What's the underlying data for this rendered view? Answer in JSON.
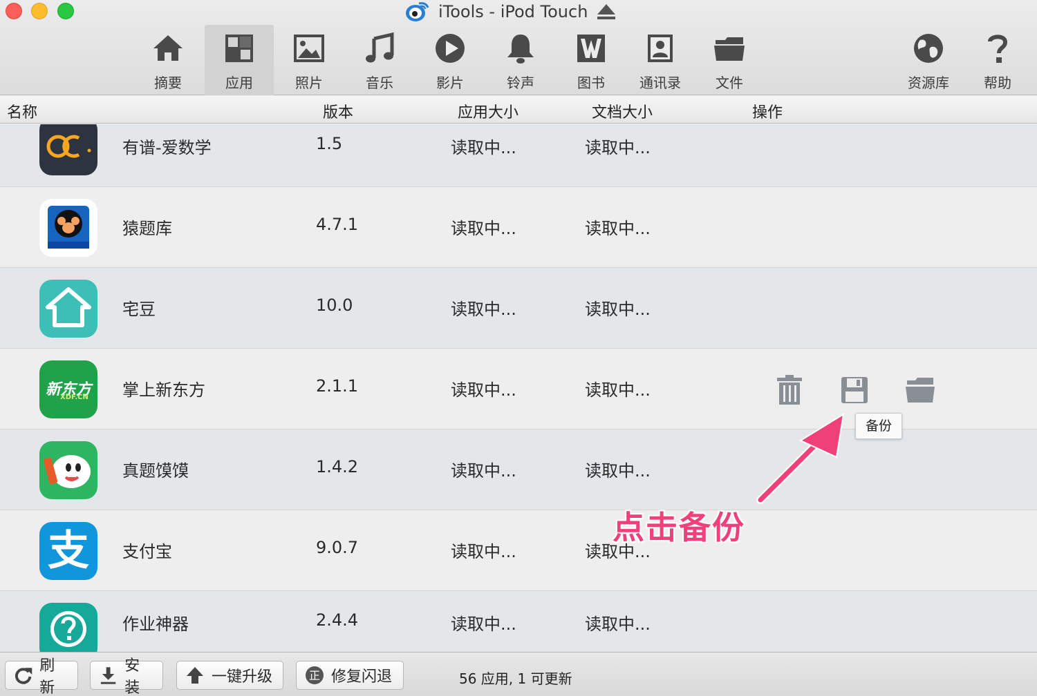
{
  "window": {
    "title": "iTools - iPod Touch"
  },
  "toolbar": {
    "items": [
      {
        "label": "摘要",
        "icon": "home-icon"
      },
      {
        "label": "应用",
        "icon": "apps-icon",
        "active": true
      },
      {
        "label": "照片",
        "icon": "photo-icon"
      },
      {
        "label": "音乐",
        "icon": "music-icon"
      },
      {
        "label": "影片",
        "icon": "play-icon"
      },
      {
        "label": "铃声",
        "icon": "bell-icon"
      },
      {
        "label": "图书",
        "icon": "book-icon"
      },
      {
        "label": "通讯录",
        "icon": "contacts-icon"
      },
      {
        "label": "文件",
        "icon": "folder-icon"
      }
    ],
    "right_items": [
      {
        "label": "资源库",
        "icon": "globe-icon"
      },
      {
        "label": "帮助",
        "icon": "help-icon"
      }
    ]
  },
  "table": {
    "columns": [
      "名称",
      "版本",
      "应用大小",
      "文档大小",
      "操作"
    ],
    "rows": [
      {
        "name": "有谱-爱数学",
        "version": "1.5",
        "app_size": "读取中...",
        "doc_size": "读取中...",
        "icon": "youpu-app-icon"
      },
      {
        "name": "猿题库",
        "version": "4.7.1",
        "app_size": "读取中...",
        "doc_size": "读取中...",
        "icon": "yuantiku-app-icon"
      },
      {
        "name": "宅豆",
        "version": "10.0",
        "app_size": "读取中...",
        "doc_size": "读取中...",
        "icon": "zhaidou-app-icon"
      },
      {
        "name": "掌上新东方",
        "version": "2.1.1",
        "app_size": "读取中...",
        "doc_size": "读取中...",
        "icon": "xdf-app-icon",
        "icon_text": "新东方",
        "icon_subtext": "XDF.CN"
      },
      {
        "name": "真题馍馍",
        "version": "1.4.2",
        "app_size": "读取中...",
        "doc_size": "读取中...",
        "icon": "zhentimomo-app-icon"
      },
      {
        "name": "支付宝",
        "version": "9.0.7",
        "app_size": "读取中...",
        "doc_size": "读取中...",
        "icon": "alipay-app-icon",
        "icon_text": "支"
      },
      {
        "name": "作业神器",
        "version": "2.4.4",
        "app_size": "读取中...",
        "doc_size": "读取中...",
        "icon": "zuoye-app-icon"
      }
    ],
    "row_actions": [
      "trash-icon",
      "save-icon",
      "folder-open-icon"
    ],
    "tooltip": "备份",
    "annotation": "点击备份",
    "annotation_color": "#f0407a"
  },
  "bottom": {
    "buttons": [
      {
        "label": "刷新",
        "icon": "refresh-icon"
      },
      {
        "label": "安装",
        "icon": "download-icon"
      },
      {
        "label": "一键升级",
        "icon": "upgrade-icon"
      },
      {
        "label": "修复闪退",
        "icon": "fix-icon",
        "icon_text": "正"
      }
    ],
    "status": "56 应用, 1 可更新"
  }
}
